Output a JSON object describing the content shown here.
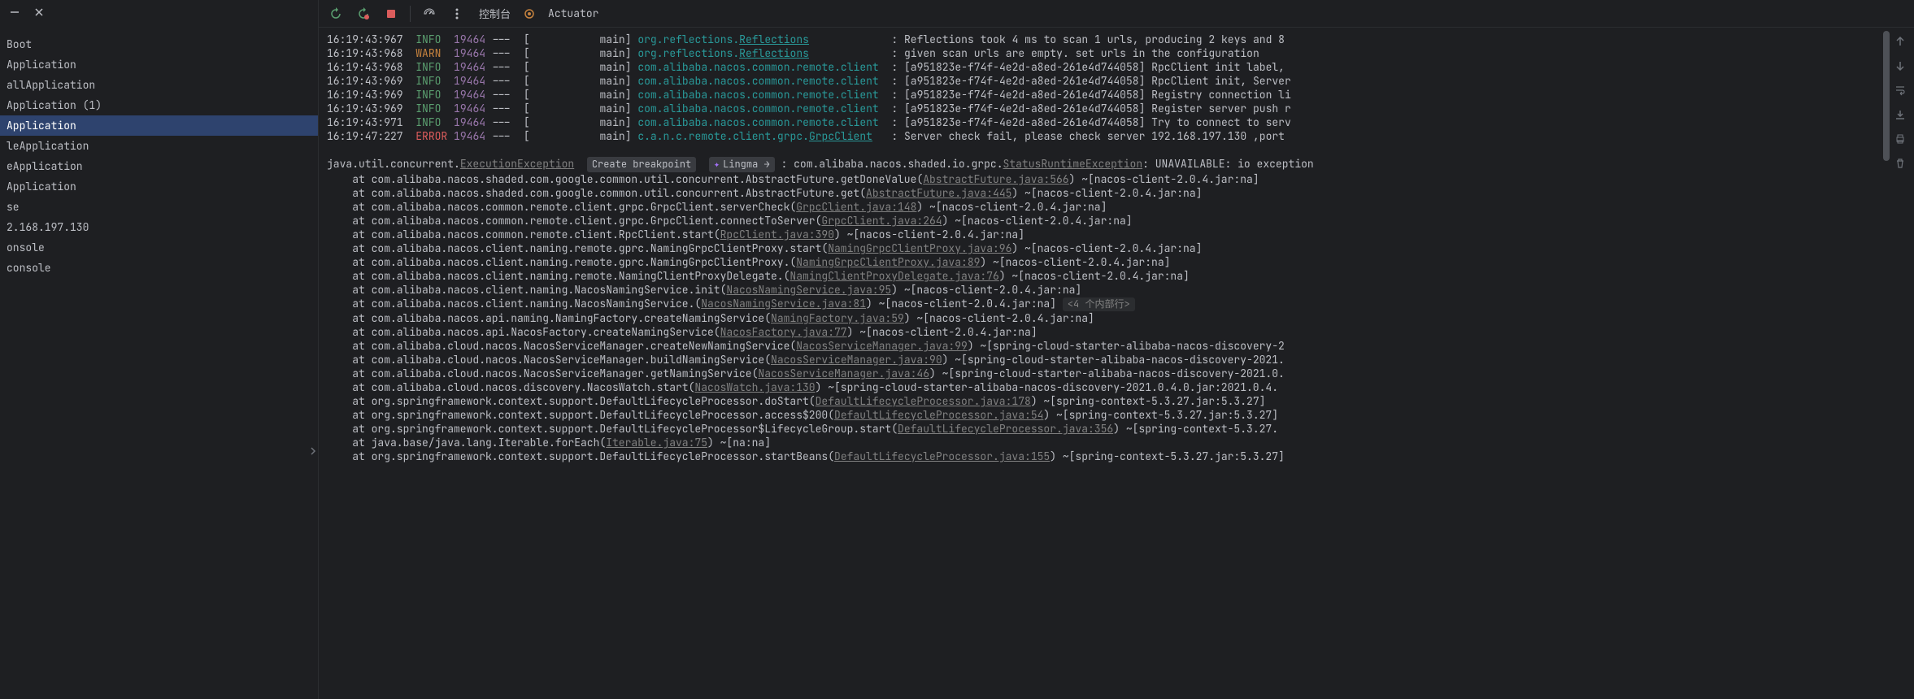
{
  "sidebar": {
    "items": [
      "Boot",
      "Application",
      "allApplication",
      "Application (1)",
      "Application",
      "leApplication",
      "eApplication",
      "Application",
      "se",
      "2.168.197.130",
      "onsole",
      "console"
    ],
    "selected_index": 4
  },
  "toolbar": {
    "console_tab": "控制台",
    "actuator_tab": "Actuator"
  },
  "badges": {
    "create_breakpoint": "Create breakpoint",
    "lingma": "Lingma",
    "inline_frames": "<4 个内部行>"
  },
  "log_lines": [
    {
      "ts": "16:19:43:967",
      "lvl": "INFO",
      "pid": "19464",
      "sep": "---  [",
      "thr": "main]",
      "logger": "org.reflections.",
      "logger_u": "Reflections",
      "colon": ":",
      "msg": "Reflections took 4 ms to scan 1 urls, producing 2 keys and 8"
    },
    {
      "ts": "16:19:43:968",
      "lvl": "WARN",
      "pid": "19464",
      "sep": "---  [",
      "thr": "main]",
      "logger": "org.reflections.",
      "logger_u": "Reflections",
      "colon": ":",
      "msg": "given scan urls are empty. set urls in the configuration"
    },
    {
      "ts": "16:19:43:968",
      "lvl": "INFO",
      "pid": "19464",
      "sep": "---  [",
      "thr": "main]",
      "logger": "com.alibaba.nacos.common.remote.client",
      "logger_u": "",
      "colon": ":",
      "msg": "[a951823e-f74f-4e2d-a8ed-261e4d744058] RpcClient init label, "
    },
    {
      "ts": "16:19:43:969",
      "lvl": "INFO",
      "pid": "19464",
      "sep": "---  [",
      "thr": "main]",
      "logger": "com.alibaba.nacos.common.remote.client",
      "logger_u": "",
      "colon": ":",
      "msg": "[a951823e-f74f-4e2d-a8ed-261e4d744058] RpcClient init, Server"
    },
    {
      "ts": "16:19:43:969",
      "lvl": "INFO",
      "pid": "19464",
      "sep": "---  [",
      "thr": "main]",
      "logger": "com.alibaba.nacos.common.remote.client",
      "logger_u": "",
      "colon": ":",
      "msg": "[a951823e-f74f-4e2d-a8ed-261e4d744058] Registry connection li"
    },
    {
      "ts": "16:19:43:969",
      "lvl": "INFO",
      "pid": "19464",
      "sep": "---  [",
      "thr": "main]",
      "logger": "com.alibaba.nacos.common.remote.client",
      "logger_u": "",
      "colon": ":",
      "msg": "[a951823e-f74f-4e2d-a8ed-261e4d744058] Register server push r"
    },
    {
      "ts": "16:19:43:971",
      "lvl": "INFO",
      "pid": "19464",
      "sep": "---  [",
      "thr": "main]",
      "logger": "com.alibaba.nacos.common.remote.client",
      "logger_u": "",
      "colon": ":",
      "msg": "[a951823e-f74f-4e2d-a8ed-261e4d744058] Try to connect to serv"
    },
    {
      "ts": "16:19:47:227",
      "lvl": "ERROR",
      "pid": "19464",
      "sep": "---  [",
      "thr": "main]",
      "logger": "c.a.n.c.remote.client.grpc.",
      "logger_u": "GrpcClient",
      "colon": ":",
      "msg": "Server check fail, please check server 192.168.197.130 ,port"
    }
  ],
  "exception": {
    "prefix": "java.util.concurrent.",
    "link": "ExecutionException",
    "tail": ": com.alibaba.nacos.shaded.io.grpc.",
    "link2": "StatusRuntimeException",
    "tail2": ": UNAVAILABLE: io exception"
  },
  "stack": [
    {
      "pre": "    at com.alibaba.nacos.shaded.com.google.common.util.concurrent.AbstractFuture.getDoneValue(",
      "link": "AbstractFuture.java:566",
      "post": ") ~[nacos-client-2.0.4.jar:na]"
    },
    {
      "pre": "    at com.alibaba.nacos.shaded.com.google.common.util.concurrent.AbstractFuture.get(",
      "link": "AbstractFuture.java:445",
      "post": ") ~[nacos-client-2.0.4.jar:na]"
    },
    {
      "pre": "    at com.alibaba.nacos.common.remote.client.grpc.GrpcClient.serverCheck(",
      "link": "GrpcClient.java:148",
      "post": ") ~[nacos-client-2.0.4.jar:na]"
    },
    {
      "pre": "    at com.alibaba.nacos.common.remote.client.grpc.GrpcClient.connectToServer(",
      "link": "GrpcClient.java:264",
      "post": ") ~[nacos-client-2.0.4.jar:na]"
    },
    {
      "pre": "    at com.alibaba.nacos.common.remote.client.RpcClient.start(",
      "link": "RpcClient.java:390",
      "post": ") ~[nacos-client-2.0.4.jar:na]"
    },
    {
      "pre": "    at com.alibaba.nacos.client.naming.remote.gprc.NamingGrpcClientProxy.start(",
      "link": "NamingGrpcClientProxy.java:96",
      "post": ") ~[nacos-client-2.0.4.jar:na]"
    },
    {
      "pre": "    at com.alibaba.nacos.client.naming.remote.gprc.NamingGrpcClientProxy.<init>(",
      "link": "NamingGrpcClientProxy.java:89",
      "post": ") ~[nacos-client-2.0.4.jar:na]"
    },
    {
      "pre": "    at com.alibaba.nacos.client.naming.remote.NamingClientProxyDelegate.<init>(",
      "link": "NamingClientProxyDelegate.java:76",
      "post": ") ~[nacos-client-2.0.4.jar:na]"
    },
    {
      "pre": "    at com.alibaba.nacos.client.naming.NacosNamingService.init(",
      "link": "NacosNamingService.java:95",
      "post": ") ~[nacos-client-2.0.4.jar:na]"
    },
    {
      "pre": "    at com.alibaba.nacos.client.naming.NacosNamingService.<init>(",
      "link": "NacosNamingService.java:81",
      "post": ") ~[nacos-client-2.0.4.jar:na]",
      "badge": true
    },
    {
      "pre": "    at com.alibaba.nacos.api.naming.NamingFactory.createNamingService(",
      "link": "NamingFactory.java:59",
      "post": ") ~[nacos-client-2.0.4.jar:na]"
    },
    {
      "pre": "    at com.alibaba.nacos.api.NacosFactory.createNamingService(",
      "link": "NacosFactory.java:77",
      "post": ") ~[nacos-client-2.0.4.jar:na]"
    },
    {
      "pre": "    at com.alibaba.cloud.nacos.NacosServiceManager.createNewNamingService(",
      "link": "NacosServiceManager.java:99",
      "post": ") ~[spring-cloud-starter-alibaba-nacos-discovery-2"
    },
    {
      "pre": "    at com.alibaba.cloud.nacos.NacosServiceManager.buildNamingService(",
      "link": "NacosServiceManager.java:90",
      "post": ") ~[spring-cloud-starter-alibaba-nacos-discovery-2021."
    },
    {
      "pre": "    at com.alibaba.cloud.nacos.NacosServiceManager.getNamingService(",
      "link": "NacosServiceManager.java:46",
      "post": ") ~[spring-cloud-starter-alibaba-nacos-discovery-2021.0."
    },
    {
      "pre": "    at com.alibaba.cloud.nacos.discovery.NacosWatch.start(",
      "link": "NacosWatch.java:130",
      "post": ") ~[spring-cloud-starter-alibaba-nacos-discovery-2021.0.4.0.jar:2021.0.4."
    },
    {
      "pre": "    at org.springframework.context.support.DefaultLifecycleProcessor.doStart(",
      "link": "DefaultLifecycleProcessor.java:178",
      "post": ") ~[spring-context-5.3.27.jar:5.3.27]"
    },
    {
      "pre": "    at org.springframework.context.support.DefaultLifecycleProcessor.access$200(",
      "link": "DefaultLifecycleProcessor.java:54",
      "post": ") ~[spring-context-5.3.27.jar:5.3.27]"
    },
    {
      "pre": "    at org.springframework.context.support.DefaultLifecycleProcessor$LifecycleGroup.start(",
      "link": "DefaultLifecycleProcessor.java:356",
      "post": ") ~[spring-context-5.3.27."
    },
    {
      "pre": "    at java.base/java.lang.Iterable.forEach(",
      "link": "Iterable.java:75",
      "post": ") ~[na:na]"
    },
    {
      "pre": "    at org.springframework.context.support.DefaultLifecycleProcessor.startBeans(",
      "link": "DefaultLifecycleProcessor.java:155",
      "post": ") ~[spring-context-5.3.27.jar:5.3.27]"
    }
  ]
}
